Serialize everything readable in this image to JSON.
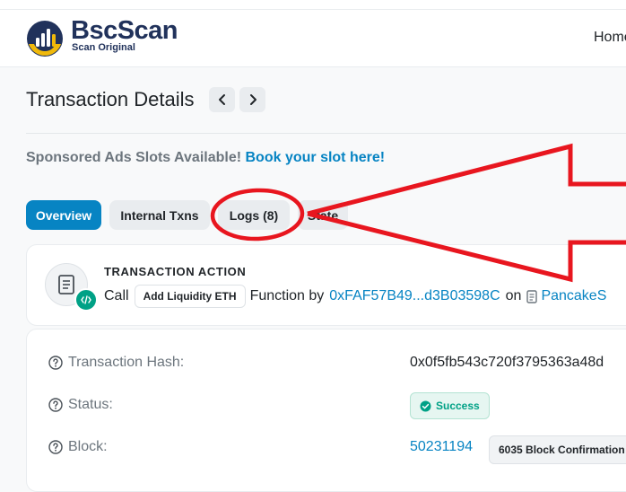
{
  "brand": {
    "title": "BscScan",
    "subtitle": "Scan Original"
  },
  "nav": {
    "home": "Home"
  },
  "page": {
    "title": "Transaction Details"
  },
  "sponsored": {
    "text": "Sponsored Ads Slots Available!",
    "link": "Book your slot here!"
  },
  "tabs": [
    {
      "label": "Overview",
      "active": true
    },
    {
      "label": "Internal Txns"
    },
    {
      "label": "Logs (8)"
    },
    {
      "label": "State"
    }
  ],
  "action": {
    "heading": "TRANSACTION ACTION",
    "call": "Call",
    "method": "Add Liquidity ETH",
    "function_by": "Function by",
    "address": "0xFAF57B49...d3B03598C",
    "on": "on",
    "contract": "PancakeS"
  },
  "details": {
    "hash_label": "Transaction Hash:",
    "hash_value": "0x0f5fb543c720f3795363a48d",
    "status_label": "Status:",
    "status_value": "Success",
    "block_label": "Block:",
    "block_value": "50231194",
    "confirmations": "6035 Block Confirmation"
  },
  "colors": {
    "accent": "#0784c3",
    "success": "#00a186",
    "annotation": "#e8161f",
    "brand_yellow": "#f0b90b",
    "brand_dark": "#21325b"
  }
}
